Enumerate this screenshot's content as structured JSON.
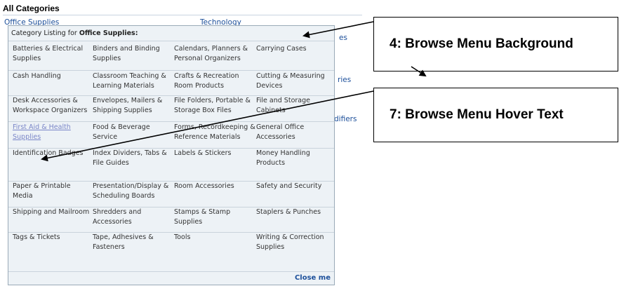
{
  "page": {
    "title": "All Categories",
    "background_text": [
      {
        "text": "Office Supplies",
        "name": "under-office-supplies"
      },
      {
        "text": "Technology",
        "name": "under-technology"
      },
      {
        "text": "es",
        "name": "under-es"
      },
      {
        "text": "ries",
        "name": "under-ries"
      },
      {
        "text": "difiers",
        "name": "under-difiers"
      }
    ]
  },
  "popup": {
    "header_prefix": "Category Listing for ",
    "header_category": "Office Supplies:",
    "rows": [
      [
        "Batteries & Electrical Supplies",
        "Binders and Binding Supplies",
        "Calendars, Planners & Personal Organizers",
        "Carrying Cases"
      ],
      [
        "Cash Handling",
        "Classroom Teaching & Learning Materials",
        "Crafts & Recreation Room Products",
        "Cutting & Measuring Devices"
      ],
      [
        "Desk Accessories & Workspace Organizers",
        "Envelopes, Mailers & Shipping Supplies",
        "File Folders, Portable & Storage Box Files",
        "File and Storage Cabinets"
      ],
      [
        "First Aid & Health Supplies",
        "Food & Beverage Service",
        "Forms, Recordkeeping & Reference Materials",
        "General Office Accessories"
      ],
      [
        "Identification Badges",
        "Index Dividers, Tabs & File Guides",
        "Labels & Stickers",
        "Money Handling Products"
      ],
      [
        "Paper & Printable Media",
        "Presentation/Display & Scheduling Boards",
        "Room Accessories",
        "Safety and Security"
      ],
      [
        "Shipping and Mailroom",
        "Shredders and Accessories",
        "Stamps & Stamp Supplies",
        "Staplers & Punches"
      ],
      [
        "Tags & Tickets",
        "Tape, Adhesives & Fasteners",
        "Tools",
        "Writing & Correction Supplies"
      ]
    ],
    "hover_item": "First Aid & Health Supplies",
    "close_label": "Close me"
  },
  "annotations": [
    {
      "label": "4: Browse Menu Background"
    },
    {
      "label": "7: Browse Menu Hover Text"
    }
  ],
  "colors": {
    "popup_bg": "#edf2f6",
    "link": "#1c4f9a",
    "hover_text": "#7a86c8"
  }
}
